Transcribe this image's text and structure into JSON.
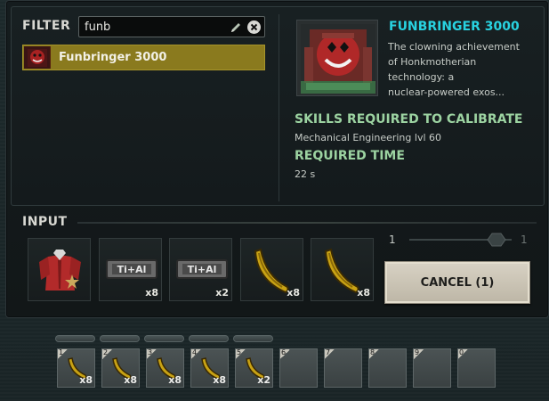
{
  "filter": {
    "label": "FILTER",
    "search_value": "funb",
    "search_placeholder": "",
    "results": [
      {
        "label": "Funbringer 3000"
      }
    ]
  },
  "details": {
    "title": "FUNBRINGER 3000",
    "description_lines": [
      "The clowning achievement",
      "of Honkmotherian",
      "technology: a",
      "nuclear-powered exos..."
    ],
    "skills_title": "SKILLS REQUIRED TO CALIBRATE",
    "skills_value": "Mechanical Engineering lvl 60",
    "time_title": "REQUIRED TIME",
    "time_value": "22 s"
  },
  "input": {
    "label": "INPUT",
    "slots": [
      {
        "icon": "clown-suit-icon",
        "count": ""
      },
      {
        "icon": "titanium-aluminium-bar-icon",
        "text": "Ti+Al",
        "count": "x8"
      },
      {
        "icon": "titanium-aluminium-bar-icon",
        "text": "Ti+Al",
        "count": "x2"
      },
      {
        "icon": "bananium-icon",
        "count": "x8"
      },
      {
        "icon": "bananium-icon",
        "count": "x8"
      }
    ],
    "quantity_slider": {
      "min_label": "1",
      "max_label": "1",
      "value": 1
    },
    "cancel_label": "CANCEL (1)"
  },
  "hotbar": {
    "slots": [
      {
        "number": "1",
        "icon": "bananium-icon",
        "count": "x8"
      },
      {
        "number": "2",
        "icon": "bananium-icon",
        "count": "x8"
      },
      {
        "number": "3",
        "icon": "bananium-icon",
        "count": "x8"
      },
      {
        "number": "4",
        "icon": "bananium-icon",
        "count": "x8"
      },
      {
        "number": "5",
        "icon": "bananium-icon",
        "count": "x2"
      },
      {
        "number": "6",
        "icon": "",
        "count": ""
      },
      {
        "number": "7",
        "icon": "",
        "count": ""
      },
      {
        "number": "8",
        "icon": "",
        "count": ""
      },
      {
        "number": "9",
        "icon": "",
        "count": ""
      },
      {
        "number": "0",
        "icon": "",
        "count": ""
      }
    ]
  },
  "colors": {
    "title_cyan": "#28d2e0",
    "section_green": "#9cd3a1",
    "selected_item": "#8a7a1e"
  }
}
